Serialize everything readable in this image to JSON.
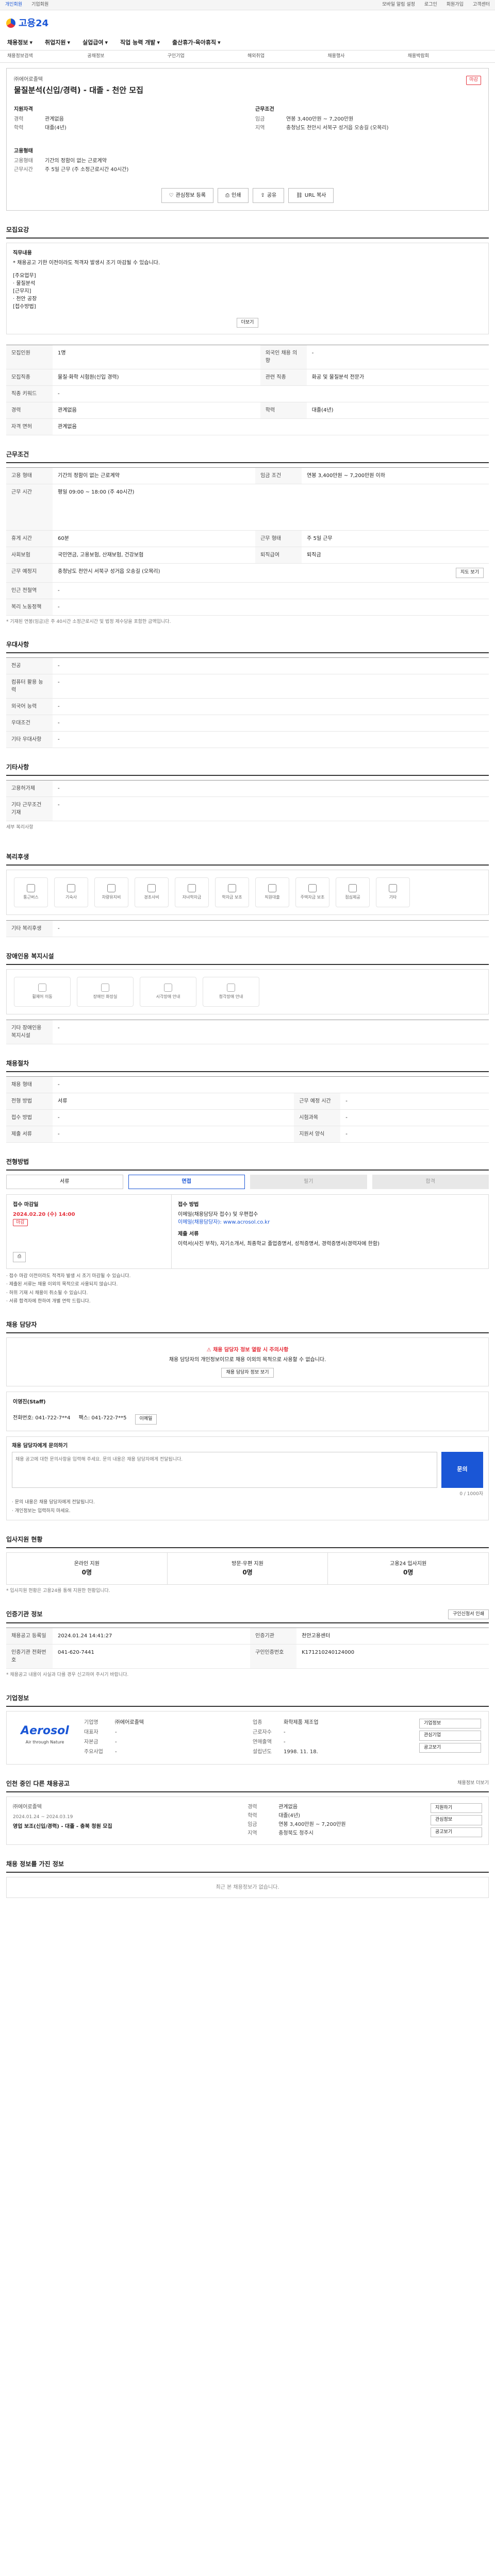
{
  "topbar": {
    "links": [
      "개인회원",
      "기업회원"
    ],
    "notice": "모바일 알림 설정",
    "right_links": [
      "로그인",
      "회원가입",
      "고객센터"
    ]
  },
  "header": {
    "logo": "고용24"
  },
  "nav": {
    "items": [
      "채용정보",
      "취업지원",
      "실업급여",
      "직업 능력 개발",
      "출산휴가·육아휴직"
    ]
  },
  "subnav": {
    "items": [
      "채용정보검색",
      "공채정보",
      "구인기업",
      "해외취업",
      "채용행사",
      "채용박람회"
    ]
  },
  "job": {
    "company": "㈜에어로졸텍",
    "title": "물질분석(신입/경력) - 대졸 - 천안 모집",
    "badge": "마감",
    "qual_label": "지원자격",
    "qual": [
      {
        "k": "경력",
        "v": "관계없음"
      },
      {
        "k": "학력",
        "v": "대졸(4년)"
      }
    ],
    "work_label": "근무조건",
    "work": [
      {
        "k": "임금",
        "v": "연봉 3,400만원 ~ 7,200만원"
      },
      {
        "k": "지역",
        "v": "충청남도 천안시 서북구 성거읍 오송길 (오목리)"
      }
    ],
    "type_label": "고용형태",
    "type": [
      {
        "k": "고용형태",
        "v": "기간의 정함이 없는 근로계약"
      },
      {
        "k": "근무시간",
        "v": "주 5일 근무 (주 소정근로시간 40시간)"
      }
    ],
    "buttons": {
      "save": "관심정보 등록",
      "print": "인쇄",
      "share": "공유",
      "copy": "URL 복사"
    }
  },
  "recruit": {
    "title": "모집요강",
    "duty_label": "직무내용",
    "duty_lines": [
      "* 채용공고 기한 이전이라도 적격자 발생시 조기 마감될 수 있습니다.",
      "[주요업무]",
      "· 물질분석",
      "[근무지]",
      "· 천안 공장",
      "[접수방법]"
    ],
    "more_label": "더보기",
    "rows": [
      {
        "k": "모집인원",
        "v": "1명",
        "k2": "외국인 채용 의향",
        "v2": "-"
      },
      {
        "k": "모집직종",
        "v": "물질·화학 시험원(신입 경력)",
        "k2": "관련 직종",
        "v2": "화공 및 물질분석 전문가"
      },
      {
        "k": "직종 키워드",
        "v": "-",
        "k2": "",
        "v2": ""
      },
      {
        "k": "경력",
        "v": "관계없음",
        "k2": "학력",
        "v2": "대졸(4년)"
      },
      {
        "k": "자격 면허",
        "v": "관계없음",
        "k2": "",
        "v2": ""
      }
    ]
  },
  "conditions": {
    "title": "근무조건",
    "rows": [
      {
        "k": "고용 형태",
        "v": "기간의 정함이 없는 근로계약",
        "k2": "임금 조건",
        "v2": "연봉 3,400만원 ~ 7,200만원 이하"
      },
      {
        "k": "근무 시간",
        "v": "평일 09:00 ~ 18:00 (주 40시간)",
        "k2": "",
        "v2": ""
      },
      {
        "k": "휴게 시간",
        "v": "60분",
        "k2": "근무 형태",
        "v2": "주 5일 근무"
      },
      {
        "k": "사회보험",
        "v": "국민연금, 고용보험, 산재보험, 건강보험",
        "k2": "퇴직급여",
        "v2": "퇴직금"
      },
      {
        "k": "근무 예정지",
        "v": "충청남도 천안시 서북구 성거읍 오송길 (오목리)",
        "k2": "",
        "v2": ""
      },
      {
        "k": "인근 전철역",
        "v": "-",
        "k2": "",
        "v2": ""
      },
      {
        "k": "복리 노동정책",
        "v": "-",
        "k2": "",
        "v2": ""
      }
    ],
    "map_label": "지도 보기",
    "note": "* 기재된 연봉(임금)은 주 40시간 소정근로시간 및 법정 제수당을 포함한 금액입니다."
  },
  "pref": {
    "title": "우대사항",
    "rows": [
      {
        "k": "전공",
        "v": "-"
      },
      {
        "k": "컴퓨터 활용 능력",
        "v": "-"
      },
      {
        "k": "외국어 능력",
        "v": "-"
      },
      {
        "k": "우대조건",
        "v": "-"
      },
      {
        "k": "기타 우대사항",
        "v": "-"
      }
    ]
  },
  "etc": {
    "title": "기타사항",
    "rows": [
      {
        "k": "고용허가제",
        "v": "-"
      },
      {
        "k": "기타 근무조건 기재",
        "v": "-"
      }
    ],
    "note": "세부 복리사항"
  },
  "welfare": {
    "title": "복리후생",
    "items": [
      "통근버스",
      "기숙사",
      "차량유지비",
      "경조사비",
      "자녀학자금",
      "학자금 보조"
    ],
    "items2": [
      "직원대출",
      "주택자금 보조",
      "점심제공",
      "기타"
    ],
    "etc_label": "기타 복리후생",
    "etc_value": "-"
  },
  "disabled": {
    "title": "장애인용 복지시설",
    "items": [
      "휠체어 이동",
      "장애인 화장실",
      "시각장애 안내",
      "청각장애 안내"
    ],
    "etc_label": "기타 장애인용 복지시설",
    "etc_value": "-"
  },
  "applyinfo": {
    "title": "채용절차",
    "rows": [
      {
        "k": "채용 형태",
        "v": "-",
        "k2": "",
        "v2": ""
      },
      {
        "k": "전형 방법",
        "v": "서류",
        "k2": "근무 예정 시간",
        "v2": "-"
      },
      {
        "k": "접수 방법",
        "v": "-",
        "k2": "시험과목",
        "v2": "-"
      },
      {
        "k": "제출 서류",
        "v": "-",
        "k2": "지원서 양식",
        "v2": "-"
      }
    ]
  },
  "process": {
    "title": "전형방법",
    "steps": [
      "서류",
      "면접",
      "필기",
      "합격"
    ],
    "deadline_label": "접수 마감일",
    "deadline": "2024.02.20 (수) 14:00",
    "deadline_note": "마감",
    "method_label": "접수 방법",
    "method": "이메일(채용담당자 접수) 및 우편접수",
    "email": "이메일(채용담당자): www.acrosol.co.kr",
    "submit_label": "제출 서류",
    "submit": "이력서(사진 부착), 자기소개서, 최종학교 졸업증명서, 성적증명서, 경력증명서(경력자에 한함)",
    "bullets": [
      "· 접수 마감 이전이라도 적격자 발생 시 조기 마감될 수 있습니다.",
      "· 제출된 서류는 채용 이외의 목적으로 사용되지 않습니다.",
      "· 허위 기재 시 채용이 취소될 수 있습니다.",
      "· 서류 합격자에 한하여 개별 연락 드립니다."
    ]
  },
  "manager": {
    "title": "채용 담당자",
    "warn1": "채용 담당자 정보 열람 시 주의사항",
    "warn2": "채용 담당자의 개인정보이므로 채용 이외의 목적으로 사용할 수 없습니다.",
    "warn_btn": "채용 담당자 정보 보기",
    "name_label": "이영진(Staff)",
    "phone": "전화번호: 041-722-7**4",
    "fax": "팩스: 041-722-7**5",
    "email_btn": "이메일"
  },
  "inquiry": {
    "title": "채용 담당자에게 문의하기",
    "placeholder": "채용 공고에 대한 문의사항을 입력해 주세요. 문의 내용은 채용 담당자에게 전달됩니다.",
    "count": "0 / 1000자",
    "send": "문의",
    "notes": [
      "· 문의 내용은 채용 담당자에게 전달됩니다.",
      "· 개인정보는 입력하지 마세요."
    ]
  },
  "stats": {
    "title": "입사지원 현황",
    "items": [
      {
        "label": "온라인 지원",
        "value": "0명"
      },
      {
        "label": "방문·우편 지원",
        "value": "0명"
      },
      {
        "label": "고용24 입사지원",
        "value": "0명"
      }
    ],
    "note": "* 입사지원 현황은 고용24를 통해 지원한 현황입니다."
  },
  "meta": {
    "title": "인증기관 정보",
    "print_btn": "구인신청서 인쇄",
    "rows": [
      {
        "k": "채용공고 등록일",
        "v": "2024.01.24 14:41:27",
        "k2": "인증기관",
        "v2": "천안고용센터"
      },
      {
        "k": "인증기관 전화번호",
        "v": "041-620-7441",
        "k2": "구인인증번호",
        "v2": "K171210240124000"
      }
    ],
    "note": "* 채용공고 내용이 사실과 다를 경우 신고하여 주시기 바랍니다."
  },
  "company_info": {
    "title": "기업정보",
    "logo_main": "Aerosol",
    "logo_sub": "Air through Nature",
    "rows": [
      {
        "k": "기업명",
        "v": "㈜에어로졸텍",
        "k2": "업종",
        "v2": "화학제품 제조업"
      },
      {
        "k": "대표자",
        "v": "-",
        "k2": "근로자수",
        "v2": "-"
      },
      {
        "k": "자본금",
        "v": "-",
        "k2": "연매출액",
        "v2": "-"
      },
      {
        "k": "주요사업",
        "v": "-",
        "k2": "설립년도",
        "v2": "1998. 11. 18."
      }
    ],
    "buttons": [
      "기업정보",
      "관심기업",
      "공고보기"
    ]
  },
  "similar": {
    "title": "인천 중인 다른 채용공고",
    "more": "채용정보 더보기",
    "company": "㈜에어로졸텍",
    "date": "2024.01.24 ~ 2024.03.19",
    "job": "영업 보조(신입/경력) - 대졸 - 충북 청원 모집",
    "info": [
      {
        "k": "경력",
        "v": "관계없음"
      },
      {
        "k": "학력",
        "v": "대졸(4년)"
      },
      {
        "k": "임금",
        "v": "연봉 3,400만원 ~ 7,200만원"
      },
      {
        "k": "지역",
        "v": "충청북도 청주시"
      }
    ],
    "buttons": [
      "지원하기",
      "관심정보",
      "공고보기"
    ]
  },
  "recent": {
    "title": "채용 정보를 가진 정보",
    "empty": "최근 본 채용정보가 없습니다."
  }
}
